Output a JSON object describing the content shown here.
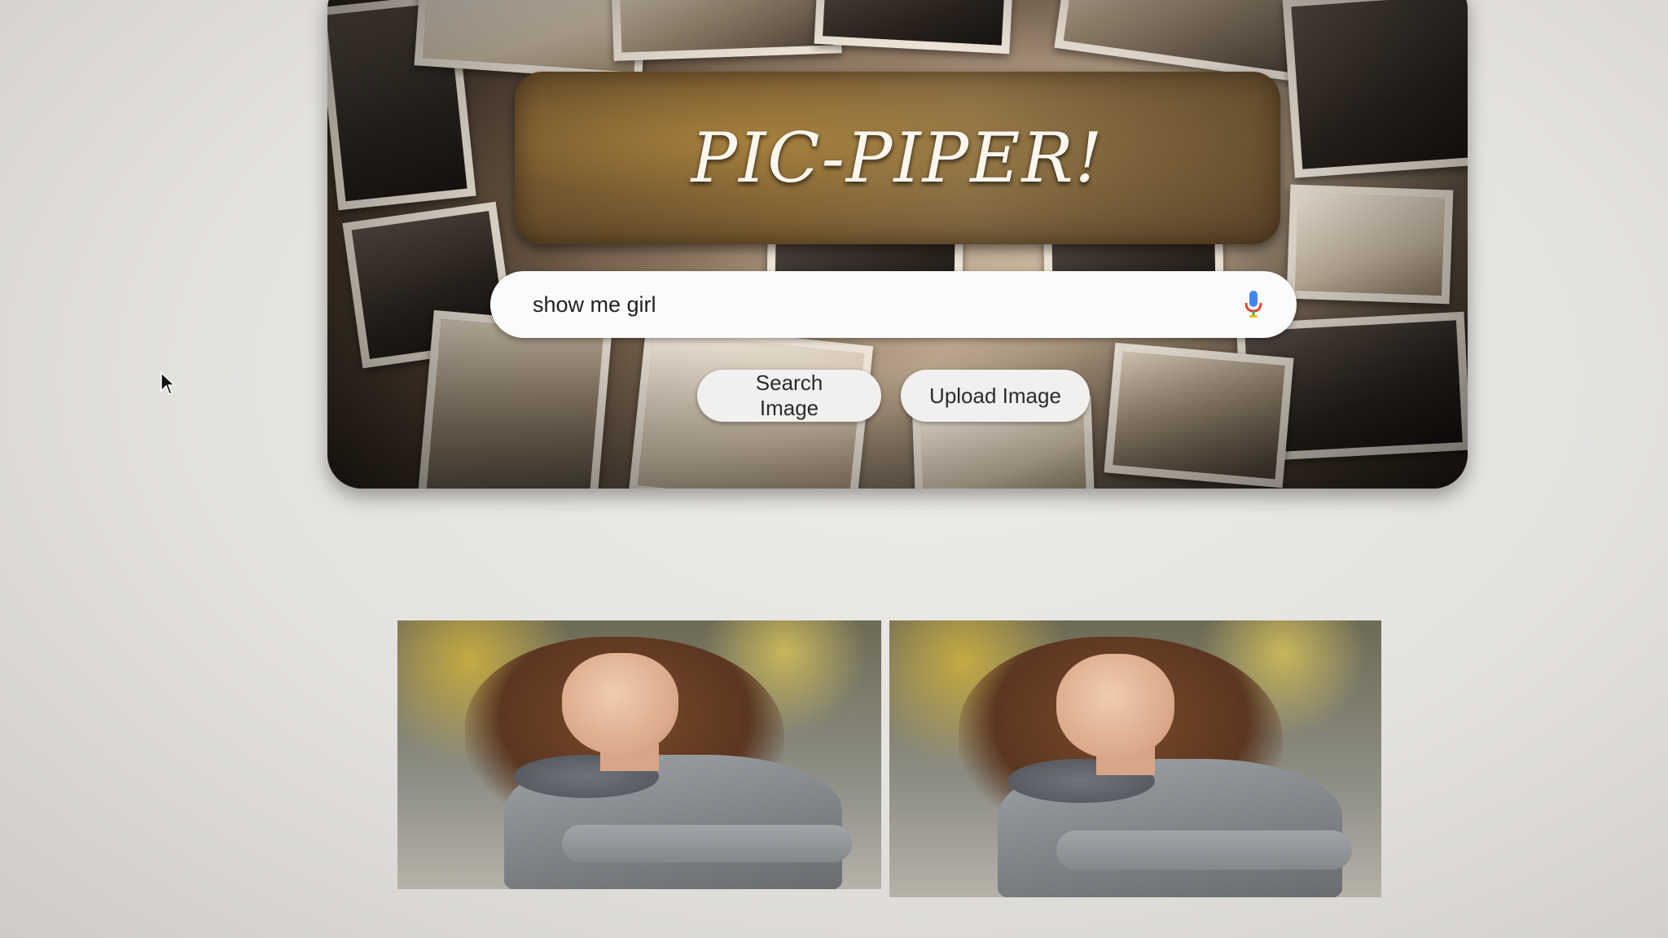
{
  "app": {
    "title": "PIC-PIPER!"
  },
  "search": {
    "value": "show me girl",
    "mic_icon": "microphone-icon"
  },
  "buttons": {
    "search_label": "Search Image",
    "upload_label": "Upload Image"
  },
  "results": {
    "images": [
      {
        "alt": "result image 1"
      },
      {
        "alt": "result image 2"
      }
    ]
  },
  "colors": {
    "plaque": "#9d7b44",
    "title_text": "#fbf6ee",
    "search_bg": "#fbfbfb",
    "button_bg": "#f1f0ee",
    "mic_blue": "#4285F4",
    "mic_red": "#EA4335"
  }
}
